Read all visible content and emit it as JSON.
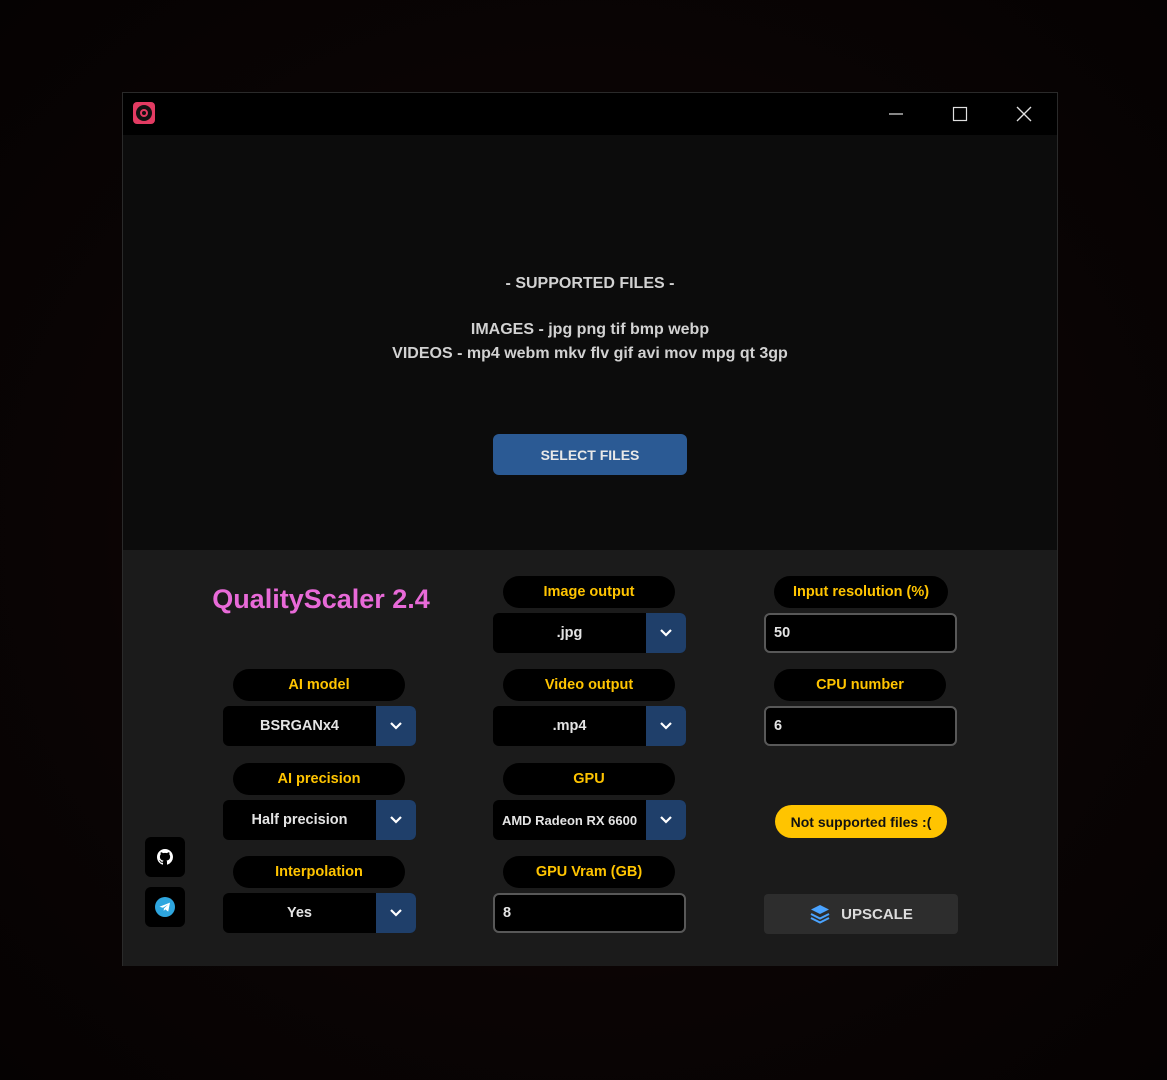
{
  "titlebar": {
    "app_icon": "qualityscaler-logo-icon",
    "controls": [
      "minimize-icon",
      "maximize-icon",
      "close-icon"
    ]
  },
  "drop_zone": {
    "supported_title": "- SUPPORTED FILES -",
    "images_line": "IMAGES - jpg png tif bmp webp",
    "videos_line": "VIDEOS - mp4 webm mkv flv gif avi mov mpg qt 3gp",
    "select_button_label": "SELECT FILES"
  },
  "panel": {
    "app_title": "QualityScaler 2.4",
    "ai_model": {
      "label": "AI model",
      "value": "BSRGANx4"
    },
    "ai_precision": {
      "label": "AI precision",
      "value": "Half precision"
    },
    "interpolation": {
      "label": "Interpolation",
      "value": "Yes"
    },
    "image_output": {
      "label": "Image output",
      "value": ".jpg"
    },
    "video_output": {
      "label": "Video output",
      "value": ".mp4"
    },
    "gpu": {
      "label": "GPU",
      "value": "AMD Radeon RX 6600"
    },
    "gpu_vram": {
      "label": "GPU Vram (GB)",
      "value": "8"
    },
    "input_resolution": {
      "label": "Input resolution (%)",
      "value": "50"
    },
    "cpu_number": {
      "label": "CPU number",
      "value": "6"
    },
    "status": "Not supported files :(",
    "upscale_label": "UPSCALE",
    "side_buttons": [
      "github-icon",
      "telegram-icon"
    ]
  },
  "colors": {
    "accent_yellow": "#ffc400",
    "title_pink": "#e86ad8",
    "select_blue": "#2b5a94",
    "dropdown_arrow_blue": "#1f3f6a"
  }
}
